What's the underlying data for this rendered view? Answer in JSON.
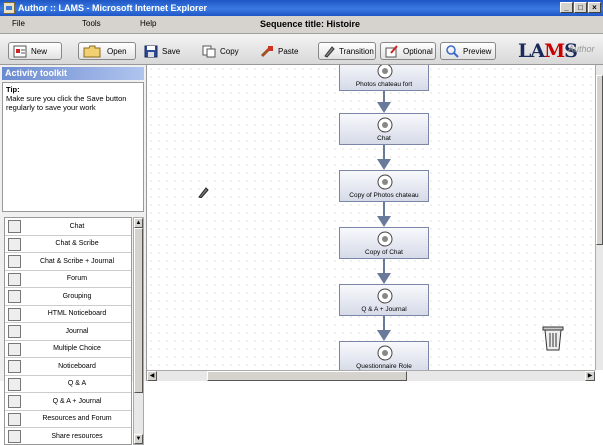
{
  "window": {
    "title": "Author :: LAMS - Microsoft Internet Explorer",
    "controls": [
      "_",
      "□",
      "×"
    ]
  },
  "menubar": {
    "items": [
      "File",
      "Tools",
      "Help"
    ],
    "sequence_title": "Sequence title: Histoire"
  },
  "toolbar": {
    "new": "New",
    "open": "Open",
    "save": "Save",
    "copy": "Copy",
    "paste": "Paste",
    "transition": "Transition",
    "optional": "Optional",
    "preview": "Preview",
    "logo_prefix": "LA",
    "logo_mid": "M",
    "logo_suffix": "S",
    "author_word": "Author"
  },
  "toolkit": {
    "header": "Activity toolkit",
    "tip_title": "Tip:",
    "tip_text": "Make sure you click the Save button regularly to save your work",
    "activities": [
      {
        "label": "Chat",
        "icon": "chat-icon"
      },
      {
        "label": "Chat & Scribe",
        "icon": "chat-scribe-icon"
      },
      {
        "label": "Chat & Scribe + Journal",
        "icon": "chat-scribe-journal-icon"
      },
      {
        "label": "Forum",
        "icon": "forum-icon"
      },
      {
        "label": "Grouping",
        "icon": "grouping-icon"
      },
      {
        "label": "HTML Noticeboard",
        "icon": "html-noticeboard-icon"
      },
      {
        "label": "Journal",
        "icon": "journal-icon"
      },
      {
        "label": "Multiple Choice",
        "icon": "multiple-choice-icon"
      },
      {
        "label": "Noticeboard",
        "icon": "noticeboard-icon"
      },
      {
        "label": "Q & A",
        "icon": "qa-icon"
      },
      {
        "label": "Q & A + Journal",
        "icon": "qa-journal-icon"
      },
      {
        "label": "Resources and Forum",
        "icon": "resources-forum-icon"
      },
      {
        "label": "Share resources",
        "icon": "share-resources-icon"
      }
    ]
  },
  "canvas": {
    "nodes": [
      {
        "label": "Photos chateau fort",
        "icon": "photos-icon"
      },
      {
        "label": "Chat",
        "icon": "chat-icon"
      },
      {
        "label": "Copy of Photos chateau",
        "icon": "photos-icon"
      },
      {
        "label": "Copy of Chat",
        "icon": "chat-icon"
      },
      {
        "label": "Q & A + Journal",
        "icon": "qa-journal-icon"
      },
      {
        "label": "Questionnaire Role",
        "icon": "questionnaire-icon"
      }
    ]
  },
  "colors": {
    "titlebar": "#1f56c6",
    "panel_header": "#6a8ad0",
    "arrow": "#6a7a9a",
    "logo_accent": "#cc0000"
  }
}
